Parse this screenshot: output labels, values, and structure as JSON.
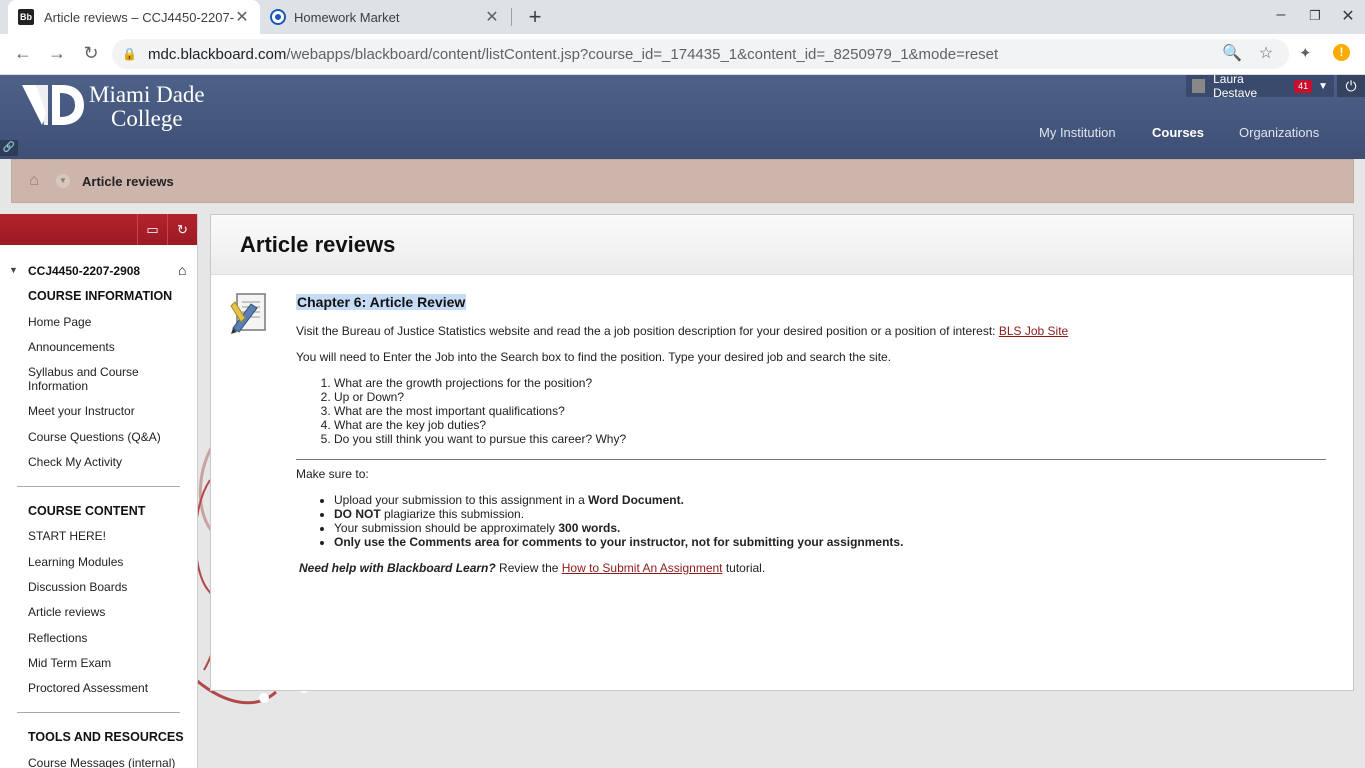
{
  "browser": {
    "tabs": [
      {
        "title": "Article reviews – CCJ4450-2207-",
        "favicon": "Bb",
        "active": true
      },
      {
        "title": "Homework Market",
        "active": false
      }
    ],
    "url_host": "mdc.blackboard.com",
    "url_path": "/webapps/blackboard/content/listContent.jsp?course_id=_174435_1&content_id=_8250979_1&mode=reset",
    "alert": "!"
  },
  "header": {
    "logo_line1": "Miami Dade",
    "logo_line2": "College",
    "user_name": "Laura Destave",
    "notification_count": "41",
    "nav": [
      "My Institution",
      "Courses",
      "Organizations"
    ]
  },
  "breadcrumb": {
    "current": "Article reviews"
  },
  "sidebar": {
    "course_id": "CCJ4450-2207-2908",
    "sections": [
      {
        "title": "COURSE INFORMATION",
        "items": [
          "Home Page",
          "Announcements",
          "Syllabus and Course Information",
          "Meet your Instructor",
          "Course Questions (Q&A)",
          "Check My Activity"
        ]
      },
      {
        "title": "COURSE CONTENT",
        "items": [
          "START HERE!",
          "Learning Modules",
          "Discussion Boards",
          "Article reviews",
          "Reflections",
          "Mid Term Exam",
          "Proctored Assessment"
        ]
      },
      {
        "title": "TOOLS AND RESOURCES",
        "items": [
          "Course Messages (internal)"
        ]
      }
    ]
  },
  "content": {
    "page_title": "Article reviews",
    "item_title": "Chapter 6: Article Review",
    "intro": "Visit the Bureau of Justice Statistics website and read the a job position description for your desired position or a position of interest: ",
    "intro_link": "BLS Job Site",
    "instruction": "You will need to Enter the Job into the Search box to find the position. Type your desired job and search the site.",
    "questions": [
      "What are the growth projections for the position?",
      "Up or Down?",
      "What are the most important qualifications?",
      "What are the key job duties?",
      "Do you still think you want to pursue this career?  Why?"
    ],
    "make_sure": "Make sure to:",
    "bullets": {
      "b1_pre": "Upload your submission to this assignment in a ",
      "b1_bold": "Word Document.",
      "b2_bold": "DO NOT",
      "b2_post": " plagiarize this submission.",
      "b3_pre": "Your submission should be approximately ",
      "b3_bold": "300 words.",
      "b4_bold": "Only use the Comments area for comments to your instructor, not for submitting your assignments."
    },
    "help_bold": "Need help with Blackboard Learn?",
    "help_pre": " Review the ",
    "help_link": "How to Submit An Assignment",
    "help_post": " tutorial."
  }
}
